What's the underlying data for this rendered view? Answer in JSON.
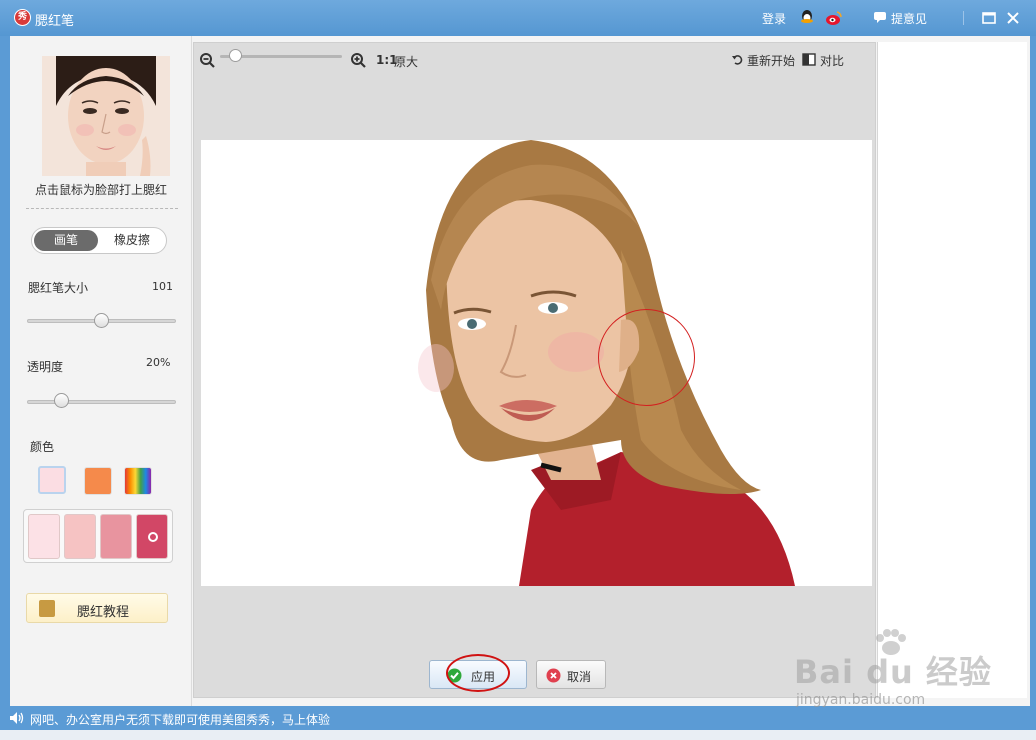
{
  "window": {
    "title": "腮红笔",
    "logo_text": "秀",
    "login": "登录",
    "feedback": "提意见"
  },
  "left_panel": {
    "hint": "点击鼠标为脸部打上腮红",
    "mode_tabs": [
      {
        "label": "画笔",
        "selected": true
      },
      {
        "label": "橡皮擦",
        "selected": false
      }
    ],
    "size_label": "腮红笔大小",
    "size_value": "101",
    "size_level": 0.5,
    "opacity_label": "透明度",
    "opacity_value": "20%",
    "opacity_level": 0.2,
    "color_label": "颜色",
    "color_options": [
      {
        "name": "light-pink",
        "color": "#fbdde3",
        "selected": true
      },
      {
        "name": "orange",
        "color": "#f58a4b",
        "selected": false
      },
      {
        "name": "rainbow",
        "color": "rainbow",
        "selected": false
      }
    ],
    "palette": [
      {
        "color": "#fce1e6"
      },
      {
        "color": "#f6c3c3"
      },
      {
        "color": "#e8949f"
      },
      {
        "color": "#d24766",
        "selected": true
      }
    ],
    "tutorial_label": "腮红教程"
  },
  "toolbar": {
    "ratio": "1:1",
    "original_size": "原大",
    "restart": "重新开始",
    "compare": "对比"
  },
  "actions": {
    "apply": "应用",
    "cancel": "取消"
  },
  "status": {
    "text": "网吧、办公室用户无须下载即可使用美图秀秀，马上体验"
  },
  "watermark": {
    "brand": "Bai du 经验",
    "url": "jingyan.baidu.com"
  }
}
